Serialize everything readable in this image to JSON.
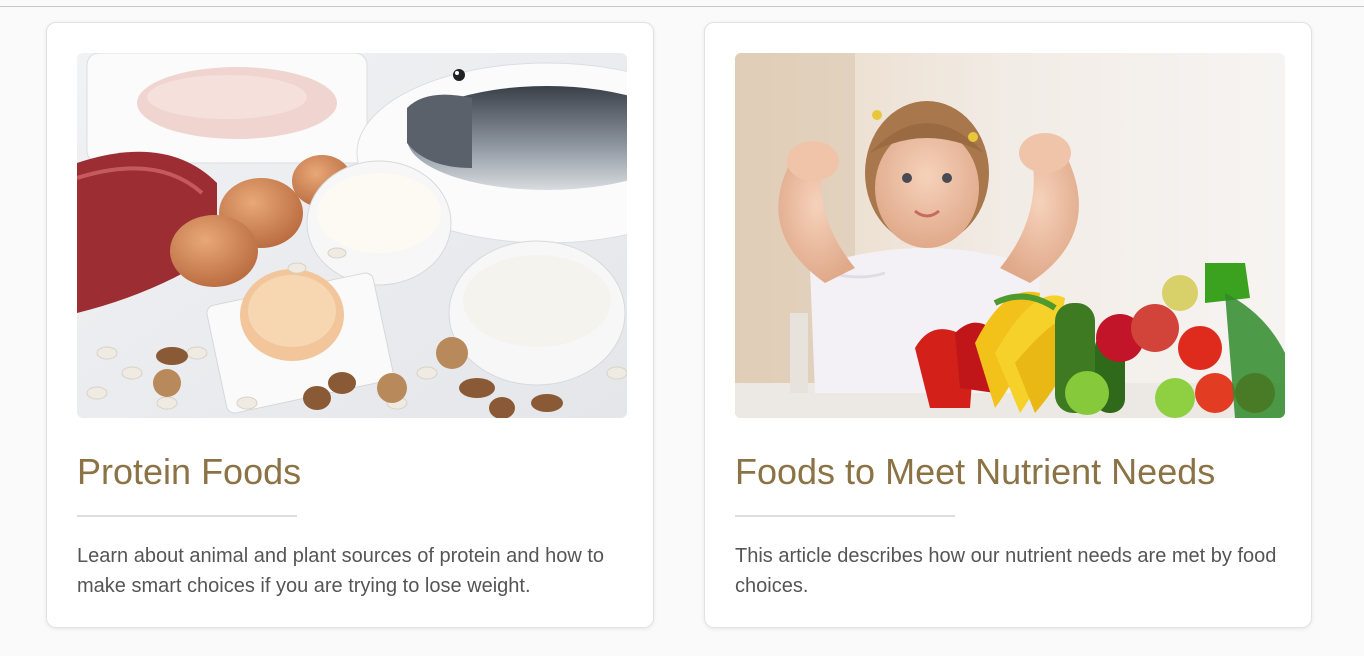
{
  "cards": [
    {
      "title": "Protein Foods",
      "description": "Learn about animal and plant sources of protein and how to make smart choices if you are trying to lose weight.",
      "image_subject": "protein-foods-photo"
    },
    {
      "title": "Foods to Meet Nutrient Needs",
      "description": "This article describes how our nutrient needs are met by food choices.",
      "image_subject": "child-with-vegetables-photo"
    }
  ],
  "colors": {
    "title": "#8b7346",
    "text": "#555555",
    "divider": "#dedede",
    "background": "#fafafa"
  }
}
